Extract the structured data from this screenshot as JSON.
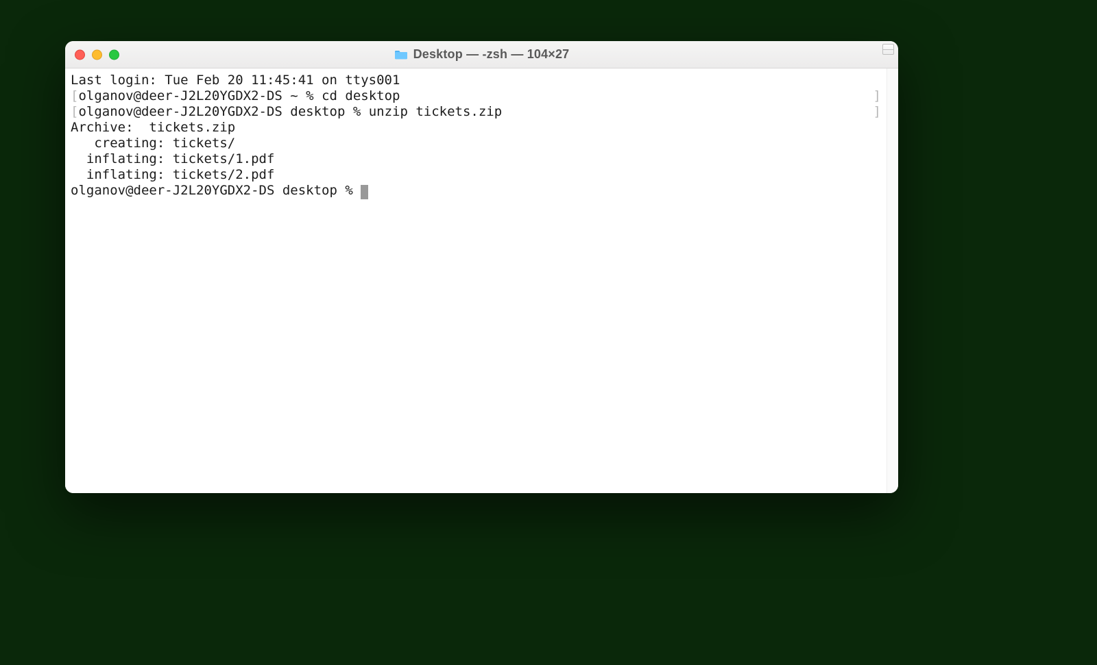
{
  "window": {
    "title": "Desktop — -zsh — 104×27",
    "folder_icon_name": "folder-icon"
  },
  "traffic": {
    "close": "close-button",
    "min": "minimize-button",
    "max": "zoom-button"
  },
  "terminal": {
    "last_login": "Last login: Tue Feb 20 11:45:41 on ttys001",
    "bracket_open": "[",
    "bracket_close": "]",
    "prompt1_left": "olganov@deer-J2L20YGDX2-DS ~ % ",
    "cmd1": "cd desktop",
    "prompt2_left": "olganov@deer-J2L20YGDX2-DS desktop % ",
    "cmd2": "unzip tickets.zip",
    "out1": "Archive:  tickets.zip",
    "out2": "   creating: tickets/",
    "out3": "  inflating: tickets/1.pdf",
    "out4": "  inflating: tickets/2.pdf",
    "prompt3": "olganov@deer-J2L20YGDX2-DS desktop % "
  }
}
